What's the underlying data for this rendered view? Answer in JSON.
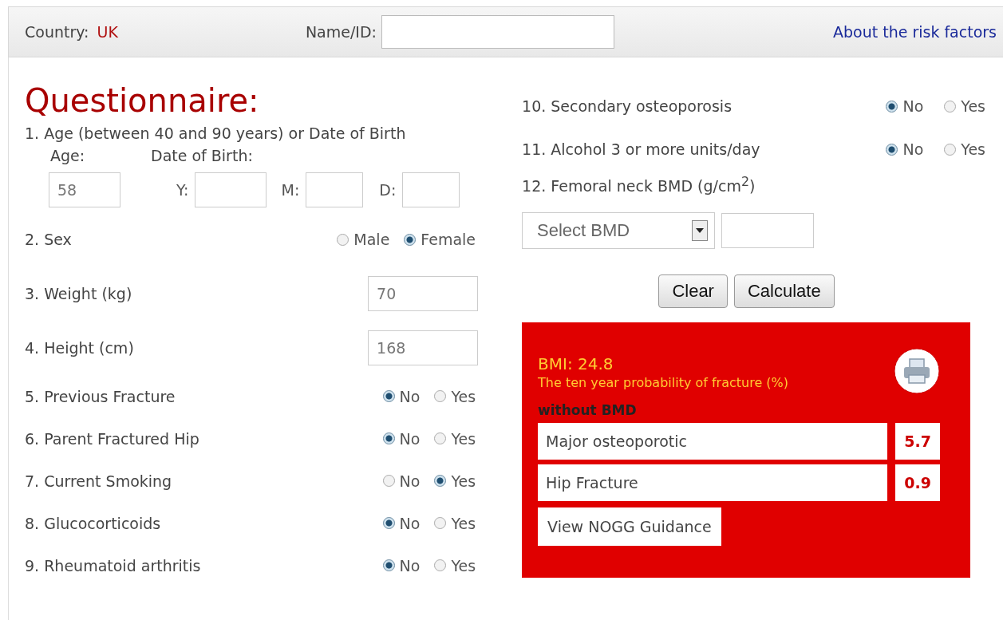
{
  "header": {
    "country_label": "Country:",
    "country": "UK",
    "name_label": "Name/ID:",
    "link": "About the risk factors"
  },
  "title": "Questionnaire:",
  "left_questions": [
    {
      "kind": "age",
      "label": "1. Age (between 40 and 90 years) or Date of Birth",
      "age_label": "Age:",
      "age_value": "58",
      "dob_label": "Date of Birth:",
      "dob_fields": [
        {
          "label": "Y:"
        },
        {
          "label": "M:"
        },
        {
          "label": "D:"
        }
      ]
    },
    {
      "kind": "radio",
      "label": "2. Sex",
      "options": [
        {
          "label": "Male",
          "selected": false
        },
        {
          "label": "Female",
          "selected": true
        }
      ]
    },
    {
      "kind": "text",
      "label": "3. Weight (kg)",
      "value": "70"
    },
    {
      "kind": "text",
      "label": "4. Height (cm)",
      "value": "168"
    },
    {
      "kind": "radio",
      "label": "5. Previous Fracture",
      "options": [
        {
          "label": "No",
          "selected": true
        },
        {
          "label": "Yes",
          "selected": false
        }
      ]
    },
    {
      "kind": "radio",
      "label": "6. Parent Fractured Hip",
      "options": [
        {
          "label": "No",
          "selected": true
        },
        {
          "label": "Yes",
          "selected": false
        }
      ]
    },
    {
      "kind": "radio",
      "label": "7. Current Smoking",
      "options": [
        {
          "label": "No",
          "selected": false
        },
        {
          "label": "Yes",
          "selected": true
        }
      ]
    },
    {
      "kind": "radio",
      "label": "8. Glucocorticoids",
      "options": [
        {
          "label": "No",
          "selected": true
        },
        {
          "label": "Yes",
          "selected": false
        }
      ]
    },
    {
      "kind": "radio",
      "label": "9. Rheumatoid arthritis",
      "options": [
        {
          "label": "No",
          "selected": true
        },
        {
          "label": "Yes",
          "selected": false
        }
      ]
    }
  ],
  "right_questions": [
    {
      "kind": "radio",
      "label": "10. Secondary osteoporosis",
      "options": [
        {
          "label": "No",
          "selected": true
        },
        {
          "label": "Yes",
          "selected": false
        }
      ]
    },
    {
      "kind": "radio",
      "label": "11. Alcohol 3 or more units/day",
      "options": [
        {
          "label": "No",
          "selected": true
        },
        {
          "label": "Yes",
          "selected": false
        }
      ]
    },
    {
      "kind": "bmd",
      "label": "12. Femoral neck BMD (g/cm$^{2}$)",
      "select": "Select BMD"
    }
  ],
  "buttons": [
    "Clear",
    "Calculate"
  ],
  "result": {
    "bmi": "BMI: 24.8",
    "caption": "The ten year probability of fracture (%)",
    "section": "without BMD",
    "rows": [
      {
        "label": "Major osteoporotic",
        "value": "5.7"
      },
      {
        "label": "Hip Fracture",
        "value": "0.9"
      }
    ],
    "link": "View NOGG Guidance"
  }
}
